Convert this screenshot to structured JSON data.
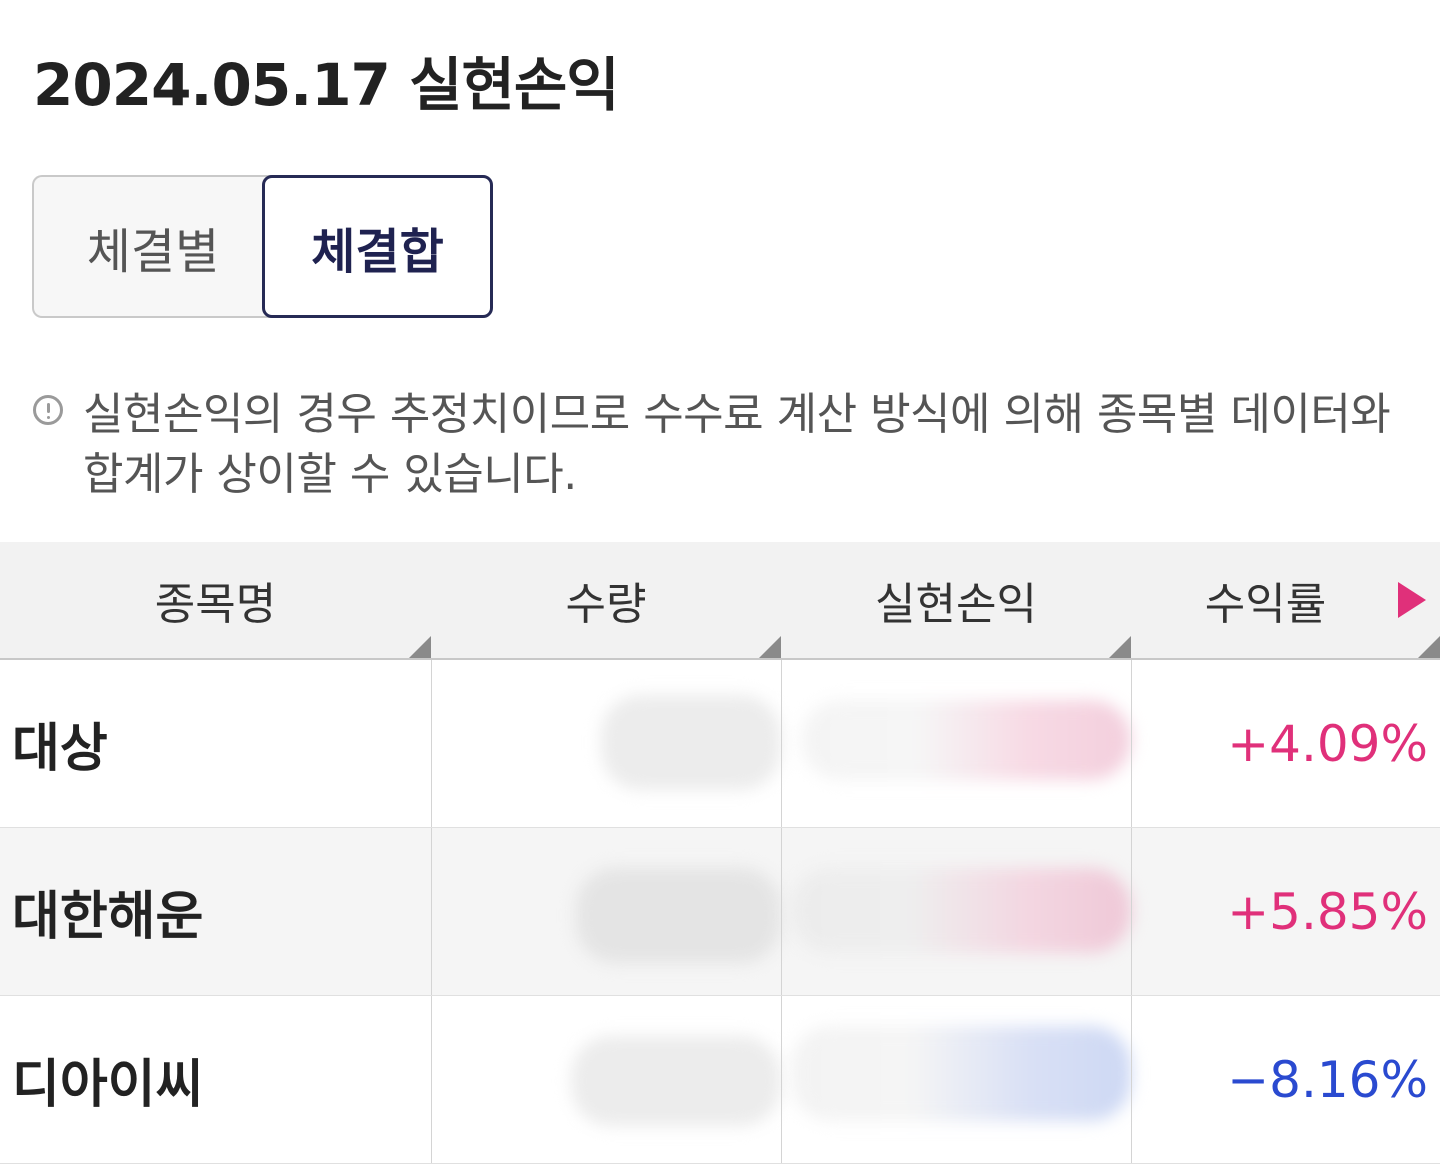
{
  "title": "2024.05.17 실현손익",
  "segment": {
    "options": [
      "체결별",
      "체결합"
    ],
    "selected": "체결합"
  },
  "notice": {
    "icon": "info-icon",
    "text": "실현손익의 경우 추정치이므로 수수료 계산 방식에 의해 종목별 데이터와 합계가 상이할 수 있습니다."
  },
  "table": {
    "columns": [
      "종목명",
      "수량",
      "실현손익",
      "수익률"
    ],
    "scroll_indicator_color": "#e0307a",
    "rows": [
      {
        "name": "대상",
        "rate": "+4.09%",
        "direction": "up"
      },
      {
        "name": "대한해운",
        "rate": "+5.85%",
        "direction": "up"
      },
      {
        "name": "디아이씨",
        "rate": "−8.16%",
        "direction": "down"
      }
    ]
  },
  "colors": {
    "positive": "#e0307a",
    "negative": "#2a4ad0",
    "selected_border": "#262a55"
  }
}
